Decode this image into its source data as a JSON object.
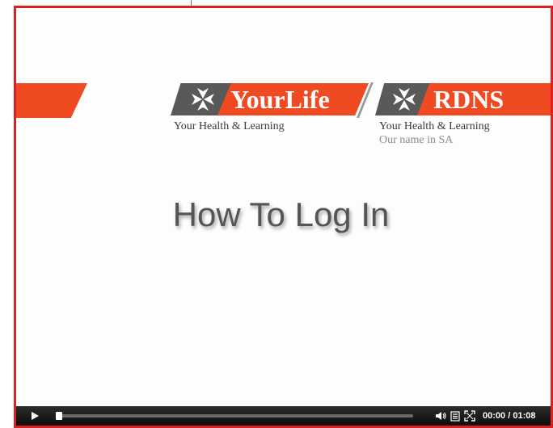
{
  "slide": {
    "yourlife_logo": "YourLife",
    "yourlife_tagline": "Your Health & Learning",
    "rdns_logo": "RDNS",
    "rdns_tagline": "Your Health & Learning",
    "rdns_subtagline": "Our name in SA",
    "title": "How To Log In"
  },
  "player": {
    "current_time": "00:00",
    "duration": "01:08",
    "progress_fraction": 0.0
  },
  "icons": {
    "play": "play-icon",
    "volume": "volume-icon",
    "captions": "captions-icon",
    "fullscreen": "fullscreen-icon",
    "logo_mark": "maltese-cross-icon"
  },
  "colors": {
    "frame_border": "#e02020",
    "brand_orange": "#f04a22",
    "brand_grey": "#595959",
    "controls_bg": "#1a1a1a"
  }
}
